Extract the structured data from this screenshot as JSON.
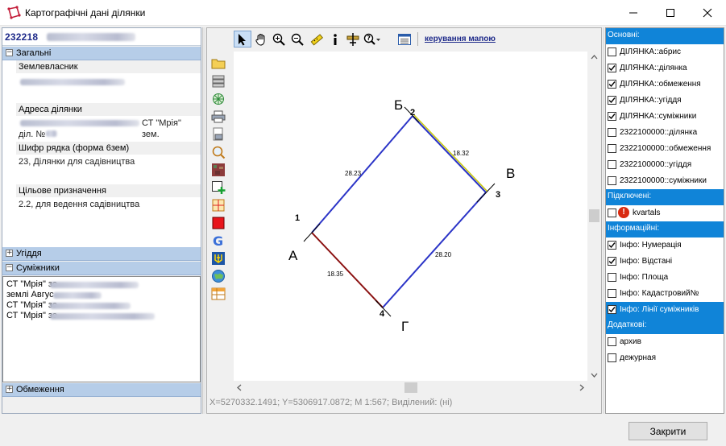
{
  "window": {
    "title": "Картографічні дані ділянки"
  },
  "left": {
    "parcel_number": "232218",
    "general": {
      "header": "Загальні",
      "owner_label": "Землевласник",
      "address_label": "Адреса ділянки",
      "address_value": "СТ \"Мрія\" зем.",
      "address_value2": "діл. №",
      "cipher_label": "Шифр рядка (форма 6зем)",
      "cipher_value": "23, Ділянки для садівництва",
      "purpose_label": "Цільове призначення",
      "purpose_value": "2.2, для ведення садівництва"
    },
    "lands_header": "Угіддя",
    "neighbors": {
      "header": "Суміжники",
      "rows": [
        "СТ \"Мрія\" зе",
        "землі Авгус",
        "СТ \"Мрія\" зе",
        "СТ \"Мрія\" зе"
      ]
    },
    "restrictions_header": "Обмеження"
  },
  "toolbar": {
    "map_control_link": "керування мапою"
  },
  "map": {
    "vertices": [
      {
        "num": "1",
        "letter": "А"
      },
      {
        "num": "2",
        "letter": "Б"
      },
      {
        "num": "3",
        "letter": "В"
      },
      {
        "num": "4",
        "letter": "Г"
      }
    ],
    "edge_lengths": {
      "a_b": "28.23",
      "b_c": "18.32",
      "c_d": "28.20",
      "d_a": "18.35"
    },
    "colors": {
      "boundary": "#2b34c7",
      "neighbor_line_b_c": "#c8c800",
      "neighbor_line_d_a": "#8b1010"
    },
    "status": "X=5270332.1491; Y=5306917.0872; M 1:567; Виділений: (ні)"
  },
  "layers": {
    "groups": [
      {
        "title": "Основні:",
        "items": [
          {
            "label": "ДІЛЯНКА::абрис",
            "checked": false
          },
          {
            "label": "ДІЛЯНКА::ділянка",
            "checked": true
          },
          {
            "label": "ДІЛЯНКА::обмеження",
            "checked": true
          },
          {
            "label": "ДІЛЯНКА::угіддя",
            "checked": true
          },
          {
            "label": "ДІЛЯНКА::суміжники",
            "checked": true
          },
          {
            "label": "2322100000::ділянка",
            "checked": false
          },
          {
            "label": "2322100000::обмеження",
            "checked": false
          },
          {
            "label": "2322100000::угіддя",
            "checked": false
          },
          {
            "label": "2322100000::суміжники",
            "checked": false
          }
        ]
      },
      {
        "title": "Підключені:",
        "items": [
          {
            "label": "kvartals",
            "checked": false
          }
        ]
      },
      {
        "title": "Інформаційні:",
        "items": [
          {
            "label": "Інфо: Нумерація",
            "checked": true
          },
          {
            "label": "Інфо: Відстані",
            "checked": true
          },
          {
            "label": "Інфо: Площа",
            "checked": false
          },
          {
            "label": "Інфо: Кадастровий№",
            "checked": false
          },
          {
            "label": "Інфо: Лінії суміжників",
            "checked": true
          }
        ]
      },
      {
        "title": "Додаткові:",
        "items": [
          {
            "label": "архив",
            "checked": false
          },
          {
            "label": "дежурная",
            "checked": false
          }
        ]
      }
    ]
  },
  "footer": {
    "close_label": "Закрити"
  }
}
